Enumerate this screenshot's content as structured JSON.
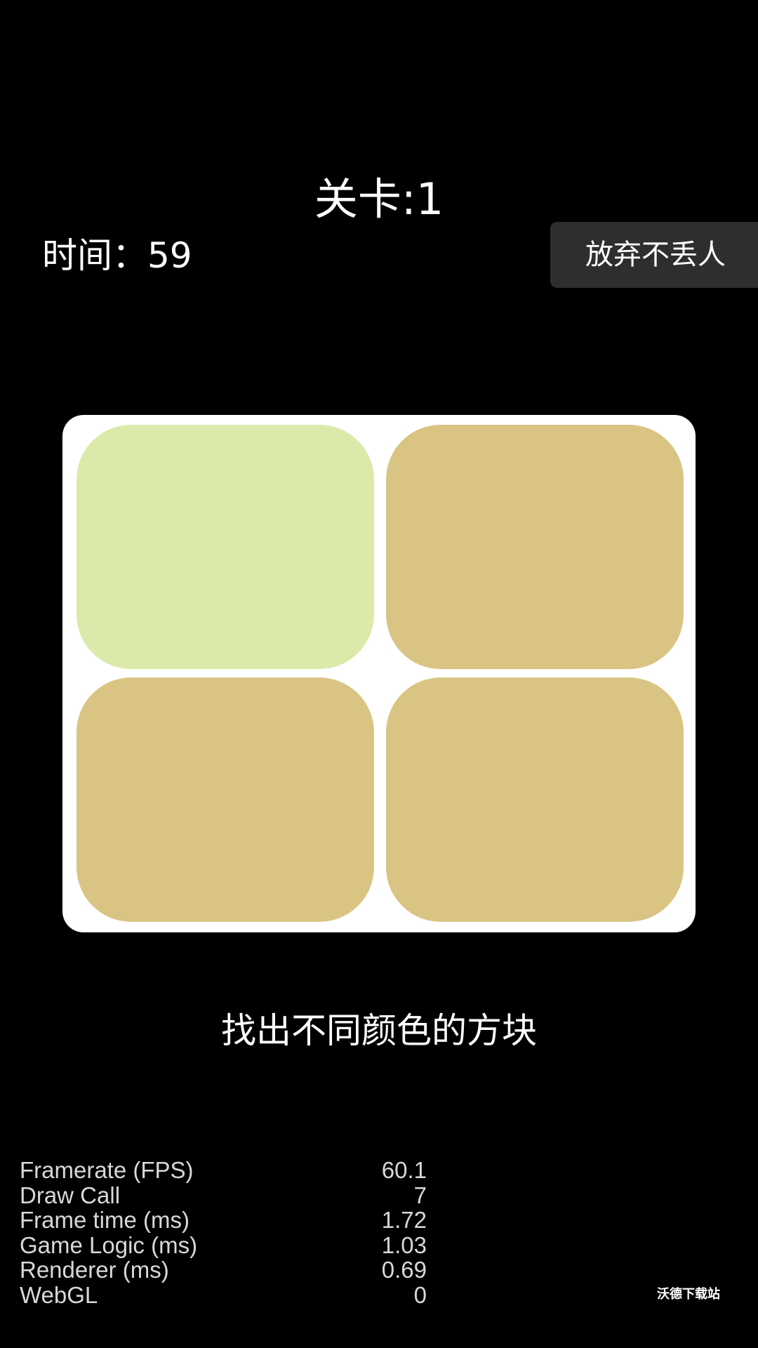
{
  "header": {
    "level_text": "关卡:1",
    "timer_text": "时间：59",
    "give_up_label": "放弃不丢人"
  },
  "board": {
    "tiles": [
      {
        "color": "#dbeaaa",
        "is_odd": true
      },
      {
        "color": "#d9c484",
        "is_odd": false
      },
      {
        "color": "#d9c484",
        "is_odd": false
      },
      {
        "color": "#d9c484",
        "is_odd": false
      }
    ]
  },
  "instruction_text": "找出不同颜色的方块",
  "stats": [
    {
      "label": "Framerate (FPS)",
      "value": "60.1"
    },
    {
      "label": "Draw Call",
      "value": "7"
    },
    {
      "label": "Frame time (ms)",
      "value": "1.72"
    },
    {
      "label": "Game Logic (ms)",
      "value": "1.03"
    },
    {
      "label": "Renderer (ms)",
      "value": "0.69"
    },
    {
      "label": "WebGL",
      "value": "0"
    }
  ],
  "watermark_text": "沃德下载站"
}
